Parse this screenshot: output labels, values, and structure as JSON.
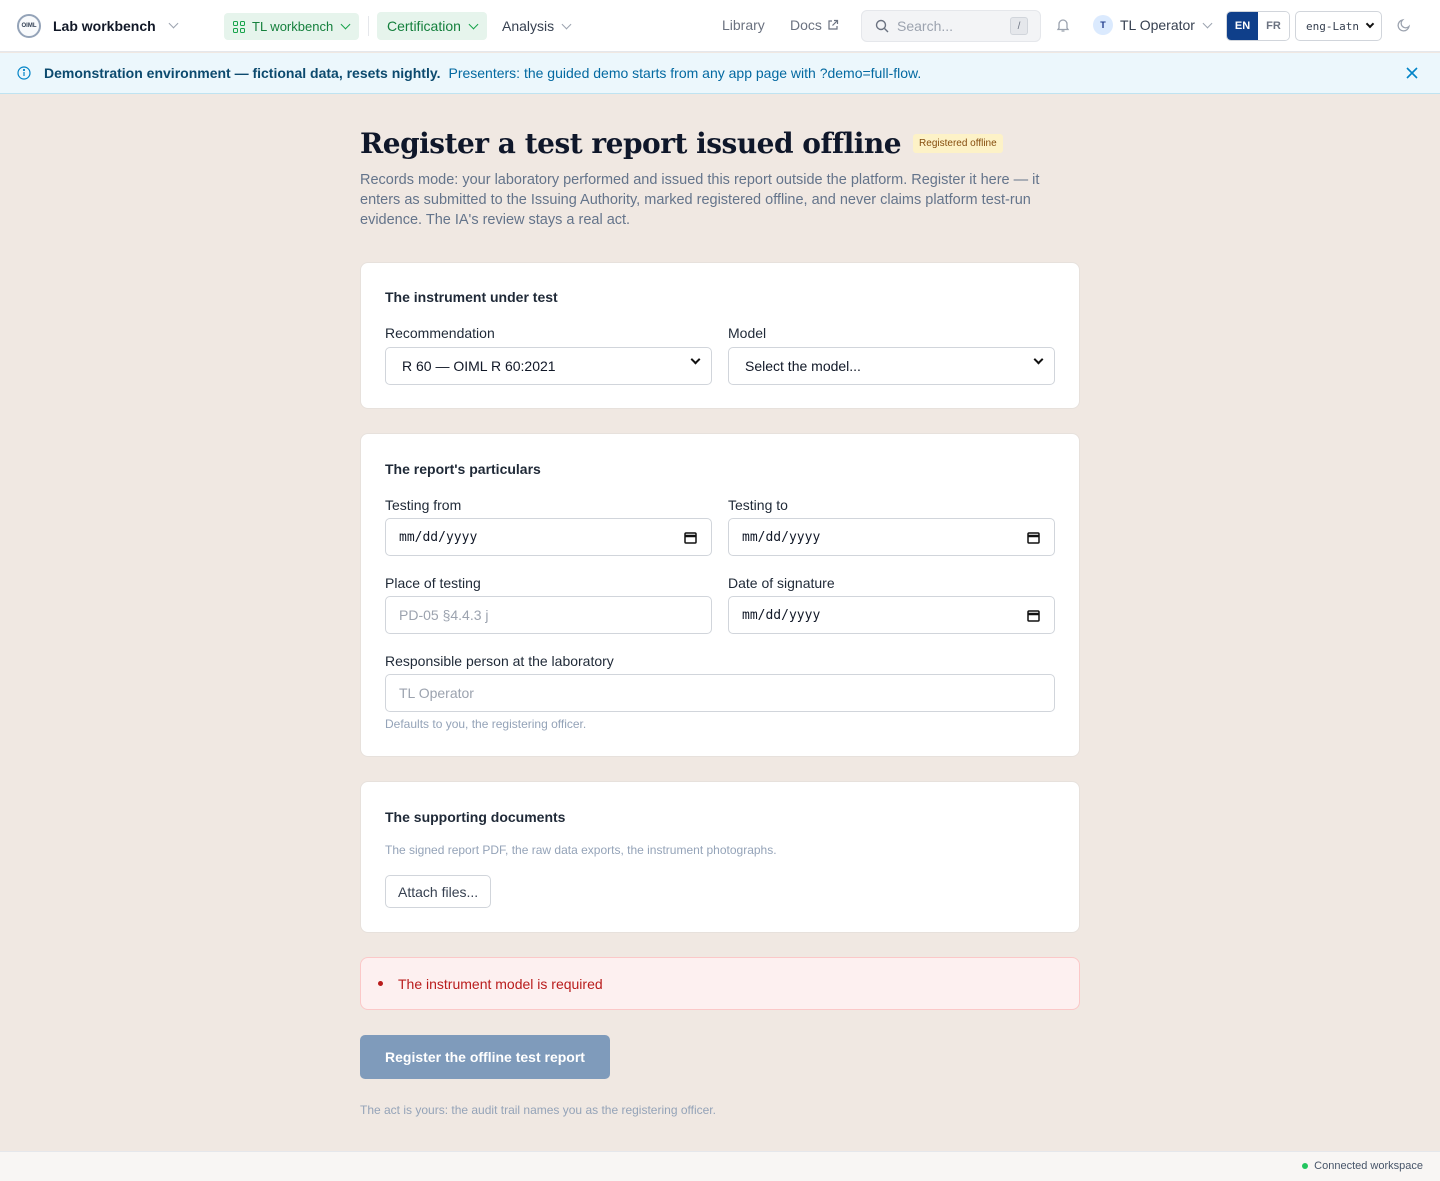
{
  "topbar": {
    "brand_logo_text": "OIML",
    "app_name": "Lab workbench",
    "workspace_switcher": "TL workbench",
    "nav": {
      "certification": "Certification",
      "analysis": "Analysis",
      "library": "Library",
      "docs": "Docs"
    },
    "search": {
      "placeholder": "Search...",
      "shortcut": "/"
    },
    "user": {
      "initial": "T",
      "name": "TL Operator"
    },
    "languages": [
      "EN",
      "FR"
    ],
    "active_language": "EN",
    "script_select": "eng-Latn"
  },
  "banner": {
    "title": "Demonstration environment — fictional data, resets nightly.",
    "message": "Presenters: the guided demo starts from any app page with ?demo=full-flow."
  },
  "page": {
    "title": "Register a test report issued offline",
    "badge": "Registered offline",
    "lead": "Records mode: your laboratory performed and issued this report outside the platform. Register it here — it enters as submitted to the Issuing Authority, marked registered offline, and never claims platform test-run evidence. The IA's review stays a real act."
  },
  "instrument": {
    "title": "The instrument under test",
    "recommendation_label": "Recommendation",
    "recommendation_value": "R 60 — OIML R 60:2021",
    "model_label": "Model",
    "model_value": "Select the model..."
  },
  "particulars": {
    "title": "The report's particulars",
    "testing_from_label": "Testing from",
    "testing_from_value": "mm/dd/yyyy",
    "testing_to_label": "Testing to",
    "testing_to_value": "mm/dd/yyyy",
    "place_label": "Place of testing",
    "place_placeholder": "PD-05 §4.4.3 j",
    "signature_label": "Date of signature",
    "signature_value": "mm/dd/yyyy",
    "responsible_label": "Responsible person at the laboratory",
    "responsible_placeholder": "TL Operator",
    "responsible_help": "Defaults to you, the registering officer."
  },
  "documents": {
    "title": "The supporting documents",
    "help": "The signed report PDF, the raw data exports, the instrument photographs.",
    "attach_label": "Attach files..."
  },
  "errors": [
    "The instrument model is required"
  ],
  "submit": {
    "label": "Register the offline test report",
    "footnote": "The act is yours: the audit trail names you as the registering officer."
  },
  "status": {
    "label": "Connected workspace",
    "color": "#22c55e"
  },
  "colors": {
    "accent": "#0f3f8a",
    "success": "#15803d",
    "error": "#b91c1c",
    "info": "#0369a1"
  }
}
